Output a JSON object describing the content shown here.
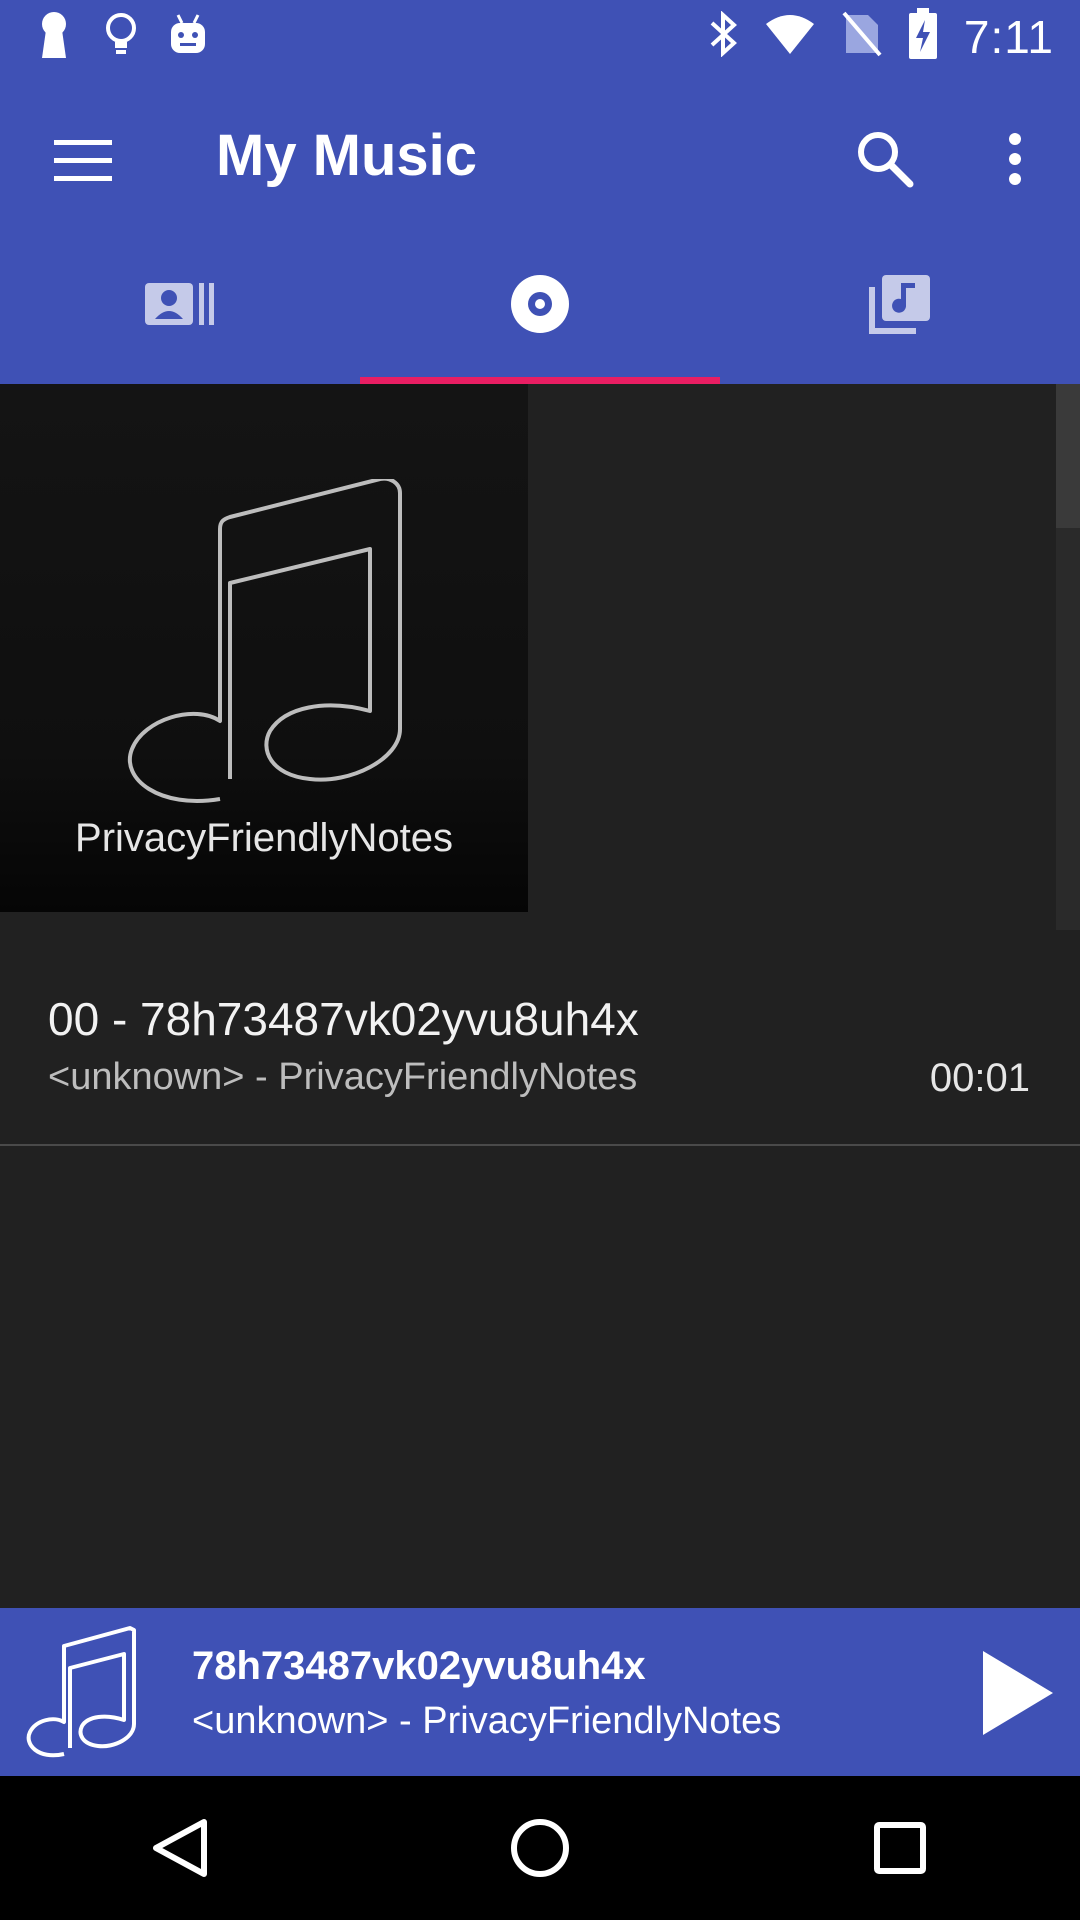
{
  "status_bar": {
    "time": "7:11",
    "left_icons": [
      "keyhole-icon",
      "lightbulb-icon",
      "android-icon"
    ],
    "right_icons": [
      "bluetooth-icon",
      "wifi-icon",
      "no-sim-icon",
      "battery-charging-icon"
    ]
  },
  "app_bar": {
    "title": "My Music",
    "icons": [
      "menu-icon",
      "search-icon",
      "more-vert-icon"
    ]
  },
  "tabs": [
    {
      "name": "artists",
      "icon": "contacts-list-icon",
      "active": false
    },
    {
      "name": "albums",
      "icon": "disc-icon",
      "active": true
    },
    {
      "name": "playlists",
      "icon": "music-library-icon",
      "active": false
    }
  ],
  "album": {
    "label": "PrivacyFriendlyNotes"
  },
  "songs": [
    {
      "title": "00 - 78h73487vk02yvu8uh4x",
      "subtitle": "<unknown> - PrivacyFriendlyNotes",
      "duration": "00:01"
    }
  ],
  "player": {
    "title": "78h73487vk02yvu8uh4x",
    "subtitle": "<unknown> - PrivacyFriendlyNotes",
    "icon": "play-icon"
  },
  "nav_bar": {
    "icons": [
      "back-icon",
      "home-icon",
      "recents-icon"
    ]
  },
  "colors": {
    "primary": "#3f51b5",
    "accent": "#e91e63",
    "background": "#212121"
  }
}
